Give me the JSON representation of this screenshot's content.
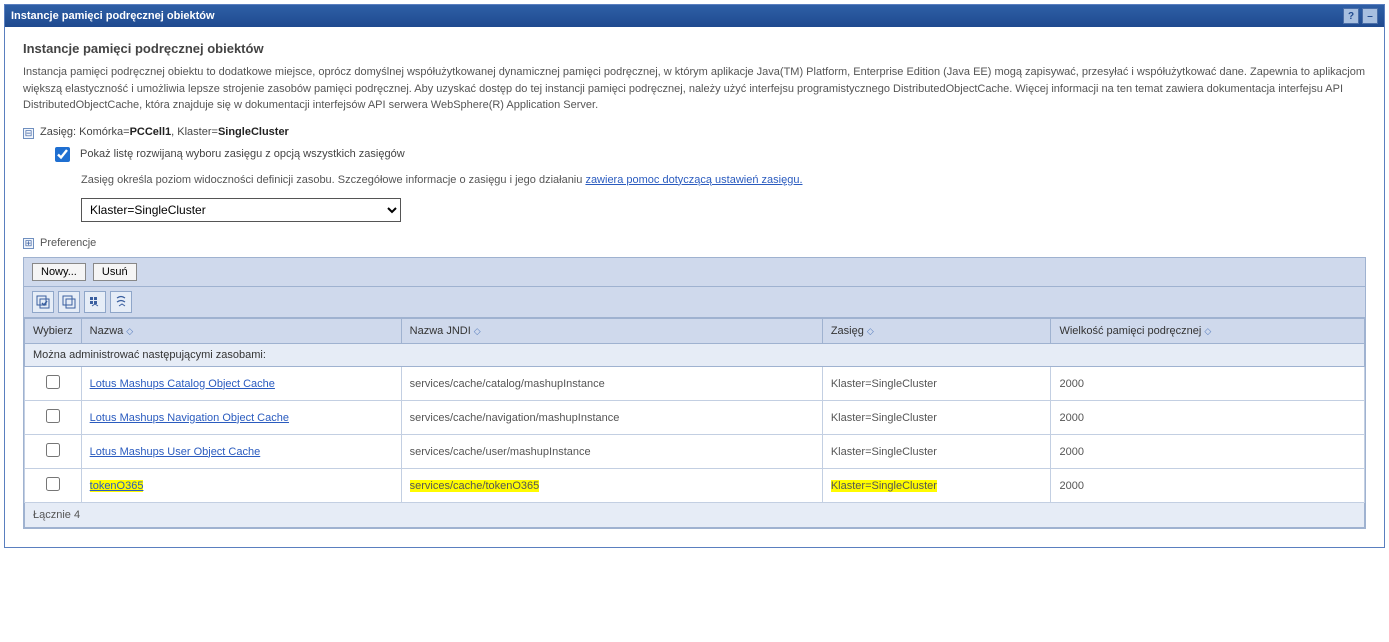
{
  "titlebar": {
    "title": "Instancje pamięci podręcznej obiektów",
    "help": "?",
    "min": "–"
  },
  "page": {
    "heading": "Instancje pamięci podręcznej obiektów",
    "description": "Instancja pamięci podręcznej obiektu to dodatkowe miejsce, oprócz domyślnej współużytkowanej dynamicznej pamięci podręcznej, w którym aplikacje Java(TM) Platform, Enterprise Edition (Java EE) mogą zapisywać, przesyłać i współużytkować dane. Zapewnia to aplikacjom większą elastyczność i umożliwia lepsze strojenie zasobów pamięci podręcznej. Aby uzyskać dostęp do tej instancji pamięci podręcznej, należy użyć interfejsu programistycznego DistributedObjectCache. Więcej informacji na ten temat zawiera dokumentacja interfejsu API DistributedObjectCache, która znajduje się w dokumentacji interfejsów API serwera WebSphere(R) Application Server."
  },
  "scope": {
    "toggle": "⊟",
    "label_prefix": "Zasięg: Komórka=",
    "cell": "PCCell1",
    "label_mid": ", Klaster=",
    "cluster": "SingleCluster",
    "checkbox_label": "Pokaż listę rozwijaną wyboru zasięgu z opcją wszystkich zasięgów",
    "help_text": "Zasięg określa poziom widoczności definicji zasobu. Szczegółowe informacje o zasięgu i jego działaniu ",
    "help_link": "zawiera pomoc dotyczącą ustawień zasięgu.",
    "select_value": "Klaster=SingleCluster"
  },
  "prefs": {
    "toggle": "⊞",
    "label": "Preferencje"
  },
  "actions": {
    "new": "Nowy...",
    "delete": "Usuń"
  },
  "columns": {
    "select": "Wybierz",
    "name": "Nazwa",
    "jndi": "Nazwa JNDI",
    "scope": "Zasięg",
    "size": "Wielkość pamięci podręcznej"
  },
  "subheader": "Można administrować następującymi zasobami:",
  "rows": [
    {
      "name": "Lotus Mashups Catalog Object Cache",
      "jndi": "services/cache/catalog/mashupInstance",
      "scope": "Klaster=SingleCluster",
      "size": "2000",
      "hl": false
    },
    {
      "name": "Lotus Mashups Navigation Object Cache",
      "jndi": "services/cache/navigation/mashupInstance",
      "scope": "Klaster=SingleCluster",
      "size": "2000",
      "hl": false
    },
    {
      "name": "Lotus Mashups User Object Cache",
      "jndi": "services/cache/user/mashupInstance",
      "scope": "Klaster=SingleCluster",
      "size": "2000",
      "hl": false
    },
    {
      "name": "tokenO365",
      "jndi": "services/cache/tokenO365",
      "scope": "Klaster=SingleCluster",
      "size": "2000",
      "hl": true
    }
  ],
  "footer": "Łącznie 4"
}
